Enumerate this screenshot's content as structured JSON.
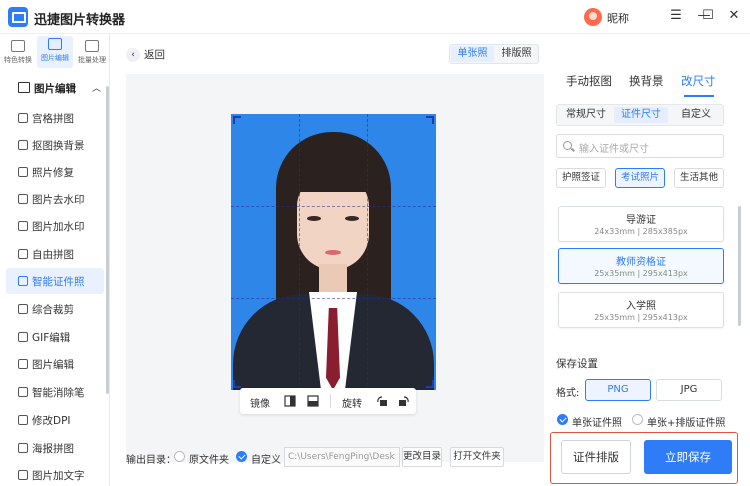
{
  "app": {
    "title": "迅捷图片转换器",
    "nickname": "昵称"
  },
  "window_controls": {
    "menu": "☰",
    "minimize": "—",
    "maximize": "☐",
    "close": "✕"
  },
  "sidebar": {
    "top_tabs": [
      {
        "label": "特色转换",
        "icon": "convert-icon"
      },
      {
        "label": "图片编辑",
        "icon": "image-edit-icon"
      },
      {
        "label": "批量处理",
        "icon": "batch-icon"
      }
    ],
    "section_title": "图片编辑",
    "section_chevron": "︿",
    "items": [
      {
        "label": "宫格拼图",
        "icon": "grid-icon"
      },
      {
        "label": "抠图换背景",
        "icon": "cutout-icon"
      },
      {
        "label": "照片修复",
        "icon": "repair-icon"
      },
      {
        "label": "图片去水印",
        "icon": "remove-watermark-icon"
      },
      {
        "label": "图片加水印",
        "icon": "add-watermark-icon"
      },
      {
        "label": "自由拼图",
        "icon": "collage-icon"
      },
      {
        "label": "智能证件照",
        "icon": "id-photo-icon"
      },
      {
        "label": "综合裁剪",
        "icon": "crop-icon"
      },
      {
        "label": "GIF编辑",
        "icon": "gif-icon"
      },
      {
        "label": "图片编辑",
        "icon": "edit-icon"
      },
      {
        "label": "智能消除笔",
        "icon": "eraser-icon"
      },
      {
        "label": "修改DPI",
        "icon": "dpi-icon"
      },
      {
        "label": "海报拼图",
        "icon": "poster-icon"
      },
      {
        "label": "图片加文字",
        "icon": "text-icon"
      }
    ]
  },
  "main": {
    "back_label": "返回",
    "mode_tabs": [
      "单张照",
      "排版照"
    ],
    "toolbar": {
      "mirror": "镜像",
      "rotate": "旋转"
    },
    "output": {
      "label": "输出目录：",
      "option_original": "原文件夹",
      "option_custom": "自定义",
      "path": "C:\\Users\\FengPing\\Desk",
      "change_dir": "更改目录",
      "open_folder": "打开文件夹"
    }
  },
  "right_panel": {
    "tabs": [
      "手动抠图",
      "换背景",
      "改尺寸"
    ],
    "size_tabs": [
      "常规尺寸",
      "证件尺寸",
      "自定义"
    ],
    "search_placeholder": "输入证件或尺寸",
    "chips": [
      "护照签证",
      "考试照片",
      "生活其他"
    ],
    "cards": [
      {
        "name": "导游证",
        "size": "24x33mm | 285x385px"
      },
      {
        "name": "教师资格证",
        "size": "25x35mm | 295x413px"
      },
      {
        "name": "入学照",
        "size": "25x35mm | 295x413px"
      }
    ],
    "save_settings": "保存设置",
    "format_label": "格式:",
    "formats": [
      "PNG",
      "JPG"
    ],
    "save_options": [
      "单张证件照",
      "单张+排版证件照"
    ],
    "layout_button": "证件排版",
    "save_button": "立即保存"
  },
  "colors": {
    "accent": "#2e7cf6",
    "photo_background": "#2e86e8",
    "highlight_border": "#e0533f"
  }
}
